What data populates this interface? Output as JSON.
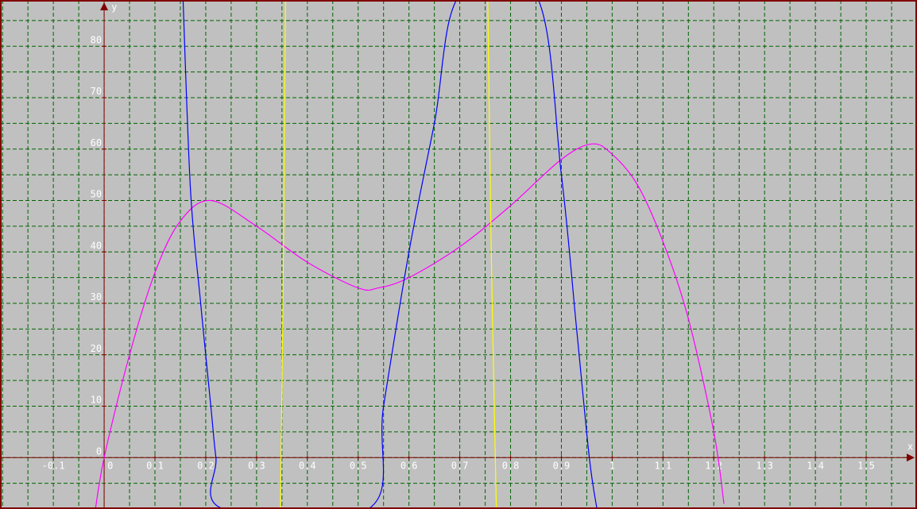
{
  "colors": {
    "background": "#c0c0c0",
    "frame": "#800000",
    "grid": "#006400",
    "axis": "#800000",
    "label": "#ffffff"
  },
  "chart_data": {
    "type": "line",
    "title": "",
    "xlabel": "x",
    "ylabel": "y",
    "xlim": [
      -0.205,
      1.6
    ],
    "ylim": [
      -10,
      89
    ],
    "grid": true,
    "grid_style": "dashed",
    "x_ticks": [
      -0.1,
      0,
      0.1,
      0.2,
      0.3,
      0.4,
      0.5,
      0.6,
      0.7,
      0.8,
      0.9,
      1,
      1.1,
      1.2,
      1.3,
      1.4,
      1.5
    ],
    "x_tick_labels": [
      "-0.1",
      "0",
      "0.1",
      "0.2",
      "0.3",
      "0.4",
      "0.5",
      "0.6",
      "0.7",
      "0.8",
      "0.9",
      "1",
      "1.1",
      "1.2",
      "1.3",
      "1.4",
      "1.5"
    ],
    "x_minor_step": 0.05,
    "y_ticks": [
      0,
      10,
      20,
      30,
      40,
      50,
      60,
      70,
      80
    ],
    "y_tick_labels": [
      "0",
      "10",
      "20",
      "30",
      "40",
      "50",
      "60",
      "70",
      "80"
    ],
    "y_minor_step": 5,
    "series": [
      {
        "color": "#ff00ff",
        "points": [
          [
            -0.02,
            -12
          ],
          [
            0,
            0
          ],
          [
            0.05,
            20
          ],
          [
            0.1,
            36
          ],
          [
            0.15,
            46
          ],
          [
            0.21,
            50
          ],
          [
            0.3,
            45
          ],
          [
            0.4,
            38
          ],
          [
            0.5,
            33
          ],
          [
            0.54,
            33
          ],
          [
            0.6,
            35
          ],
          [
            0.7,
            41
          ],
          [
            0.8,
            49
          ],
          [
            0.9,
            58
          ],
          [
            0.96,
            61
          ],
          [
            1.0,
            59
          ],
          [
            1.05,
            53
          ],
          [
            1.1,
            42
          ],
          [
            1.15,
            27
          ],
          [
            1.2,
            5
          ],
          [
            1.22,
            -9
          ]
        ]
      },
      {
        "color": "#0000ff",
        "points": [
          [
            0.155,
            90
          ],
          [
            0.17,
            52
          ],
          [
            0.19,
            30
          ],
          [
            0.21,
            10
          ],
          [
            0.22,
            0
          ],
          [
            0.235,
            -10
          ],
          [
            0.52,
            -10
          ],
          [
            0.55,
            10
          ],
          [
            0.6,
            40
          ],
          [
            0.65,
            65
          ],
          [
            0.7,
            90
          ],
          [
            0.85,
            90
          ],
          [
            0.9,
            55
          ],
          [
            0.93,
            25
          ],
          [
            0.955,
            0
          ],
          [
            0.97,
            -10
          ]
        ]
      },
      {
        "color": "#ffff00",
        "points": [
          [
            0.347,
            -10
          ],
          [
            0.352,
            30
          ],
          [
            0.357,
            90
          ]
        ]
      },
      {
        "color": "#ffff00",
        "points": [
          [
            0.755,
            90
          ],
          [
            0.762,
            40
          ],
          [
            0.772,
            -10
          ]
        ]
      }
    ]
  }
}
